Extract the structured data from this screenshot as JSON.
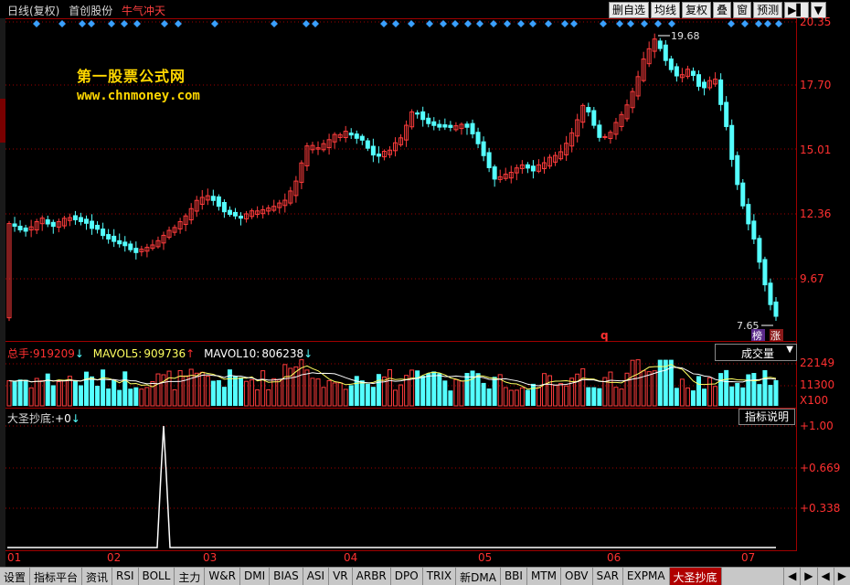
{
  "header": {
    "period": "日线(复权)",
    "stock_name": "首创股份",
    "formula_name": "牛气冲天",
    "buttons": [
      "删自选",
      "均线",
      "复权",
      "叠",
      "窗",
      "预测",
      "▶▌",
      "▼"
    ]
  },
  "watermark": {
    "line1": "第一股票公式网",
    "line2": "www.chnmoney.com"
  },
  "price_axis": [
    "20.35",
    "17.70",
    "15.01",
    "12.36",
    "9.67"
  ],
  "price_annotations": {
    "high": "19.68",
    "low": "7.65",
    "marker_q": "q",
    "badge_bang": "榜",
    "badge_zhang": "涨"
  },
  "volume": {
    "label": "总手:",
    "value": "919209",
    "ma5_label": "MAVOL5:",
    "ma5_value": "909736",
    "ma10_label": "MAVOL10:",
    "ma10_value": "806238",
    "selector": "成交量",
    "axis": [
      "22149",
      "11300",
      "X100"
    ]
  },
  "indicator": {
    "label": "大圣抄底:",
    "value": "+0",
    "explain_button": "指标说明",
    "axis": [
      "+1.00",
      "+0.669",
      "+0.338"
    ]
  },
  "months": [
    "01",
    "02",
    "03",
    "04",
    "05",
    "06",
    "07"
  ],
  "tabs": [
    "设置",
    "指标平台",
    "资讯",
    "RSI",
    "BOLL",
    "主力",
    "W&R",
    "DMI",
    "BIAS",
    "ASI",
    "VR",
    "ARBR",
    "DPO",
    "TRIX",
    "新DMA",
    "BBI",
    "MTM",
    "OBV",
    "SAR",
    "EXPMA",
    "大圣抄底"
  ],
  "active_tab": "大圣抄底",
  "tab_nav": [
    "◀",
    "▶",
    "◀",
    "▶"
  ],
  "colors": {
    "up": "#ff3c3c",
    "down": "#54ffff",
    "grid": "#a00000",
    "diamond": "#3aa0ff",
    "watermark": "#ffd700"
  },
  "chart_data": {
    "type": "candlestick",
    "ylim": [
      7.65,
      20.35
    ],
    "high": 19.68,
    "low": 7.65,
    "months": [
      "01",
      "02",
      "03",
      "04",
      "05",
      "06",
      "07"
    ],
    "indicator_peak": 1.0
  }
}
